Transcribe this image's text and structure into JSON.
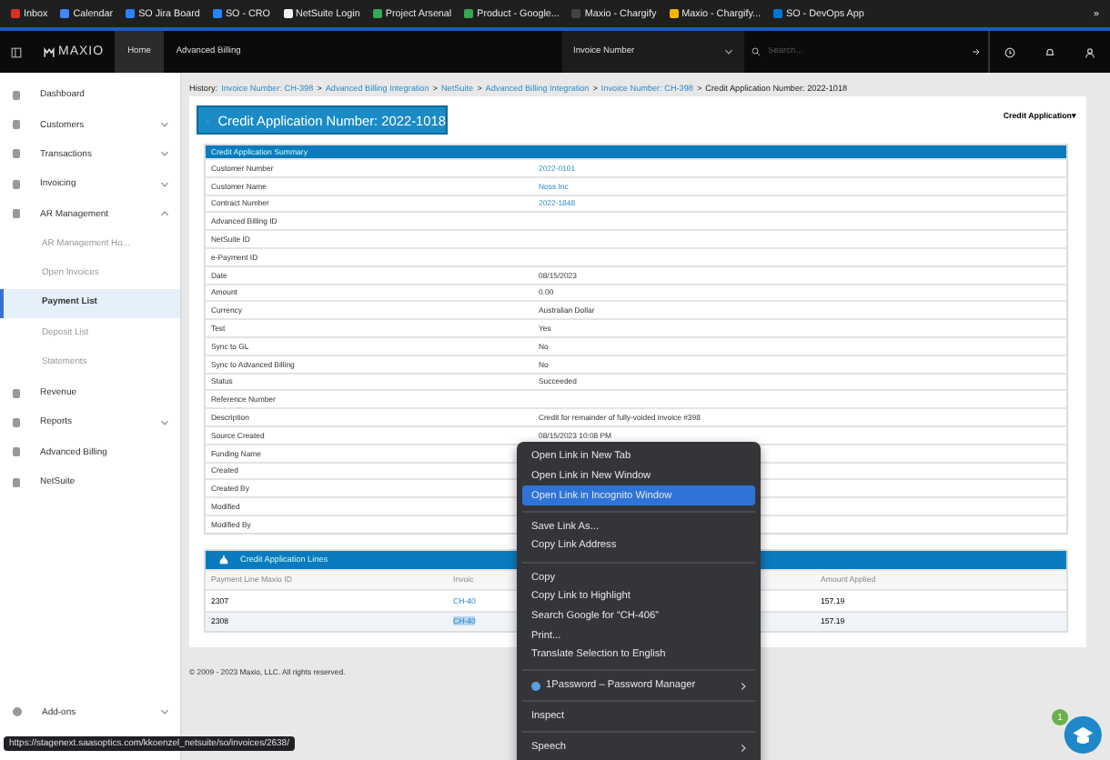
{
  "bookmarks": [
    {
      "label": "Inbox",
      "color": "#d93025"
    },
    {
      "label": "Calendar",
      "color": "#4285f4"
    },
    {
      "label": "SO Jira Board",
      "color": "#2684ff"
    },
    {
      "label": "SO - CRO",
      "color": "#2684ff"
    },
    {
      "label": "NetSuite Login",
      "color": "#f2f2f2"
    },
    {
      "label": "Project Arsenal",
      "color": "#34a853"
    },
    {
      "label": "Product - Google...",
      "color": "#34a853"
    },
    {
      "label": "Maxio - Chargify",
      "color": "#444444"
    },
    {
      "label": "Maxio - Chargify...",
      "color": "#f4b400"
    },
    {
      "label": "SO - DevOps App",
      "color": "#0078d4"
    }
  ],
  "bookmarks_more": "»",
  "nav": {
    "logo": "MAXIO",
    "tabs": [
      {
        "label": "Home",
        "selected": true
      },
      {
        "label": "Advanced Billing",
        "selected": false
      }
    ],
    "search_type": "Invoice Number",
    "search_placeholder": "Search..."
  },
  "sidebar": {
    "items": [
      {
        "label": "Dashboard",
        "selected": false
      },
      {
        "label": "Customers",
        "selected": false,
        "expanded": false
      },
      {
        "label": "Transactions",
        "selected": false,
        "expanded": false
      },
      {
        "label": "Invoicing",
        "selected": false,
        "expanded": false
      },
      {
        "label": "AR Management",
        "selected": false,
        "expanded": true,
        "children": [
          {
            "label": "AR Management Ho...",
            "selected": false
          },
          {
            "label": "Open Invoices",
            "selected": false
          },
          {
            "label": "Payment List",
            "selected": true
          },
          {
            "label": "Deposit List",
            "selected": false
          },
          {
            "label": "Statements",
            "selected": false
          }
        ]
      },
      {
        "label": "Revenue",
        "selected": false
      },
      {
        "label": "Reports",
        "selected": false,
        "expanded": false
      },
      {
        "label": "Advanced Billing",
        "selected": false
      },
      {
        "label": "NetSuite",
        "selected": false
      }
    ],
    "footer_item": {
      "label": "Add-ons",
      "expanded": false
    }
  },
  "breadcrumb": [
    {
      "kind": "label",
      "text": "History:"
    },
    {
      "kind": "link",
      "text": "Invoice Number: CH-398"
    },
    {
      "kind": "sep",
      "text": ">"
    },
    {
      "kind": "link",
      "text": "Advanced Billing Integration"
    },
    {
      "kind": "sep",
      "text": ">"
    },
    {
      "kind": "link",
      "text": "NetSuite"
    },
    {
      "kind": "sep",
      "text": ">"
    },
    {
      "kind": "link",
      "text": "Advanced Billing Integration"
    },
    {
      "kind": "sep",
      "text": ">"
    },
    {
      "kind": "link",
      "text": "Invoice Number: CH-398"
    },
    {
      "kind": "sep",
      "text": ">"
    },
    {
      "kind": "current",
      "text": "Credit Application Number: 2022-1018"
    }
  ],
  "title": "Credit Application Number: 2022-1018",
  "actions_menu": "Credit Application▾",
  "summary": {
    "heading": "Credit Application Summary",
    "rows": [
      {
        "label": "Customer Number",
        "value": "2022-0101",
        "link": true
      },
      {
        "label": "Customer Name",
        "value": "Noss Inc",
        "link": true
      },
      {
        "label": "Contract Number",
        "value": "2022-1848",
        "link": true
      },
      {
        "label": "Advanced Billing ID"
      },
      {
        "label": "NetSuite ID"
      },
      {
        "label": "e-Payment ID"
      },
      {
        "label": "Date",
        "value": "08/15/2023",
        "link": false
      },
      {
        "label": "Amount",
        "value": "0.00",
        "link": false
      },
      {
        "label": "Currency",
        "value": "Australian Dollar",
        "link": false
      },
      {
        "label": "Test",
        "value": "Yes",
        "link": false
      },
      {
        "label": "Sync to GL",
        "value": "No",
        "link": false
      },
      {
        "label": "Sync to Advanced Billing",
        "value": "No",
        "link": false
      },
      {
        "label": "Status",
        "value": "Succeeded",
        "link": false
      },
      {
        "label": "Reference Number"
      },
      {
        "label": "Description",
        "value": "Credit for remainder of fully-voided invoice #398",
        "link": false
      },
      {
        "label": "Source Created",
        "value": "08/15/2023 10:08 PM",
        "link": false
      },
      {
        "label": "Funding Name"
      },
      {
        "label": "Created"
      },
      {
        "label": "Created By"
      },
      {
        "label": "Modified"
      },
      {
        "label": "Modified By"
      }
    ]
  },
  "lines": {
    "heading": "Credit Application Lines",
    "columns": [
      "Payment Line Maxio ID",
      "Invoic",
      "Amount Applied"
    ],
    "rows": [
      {
        "id": "2307",
        "invoice": "CH-40",
        "amount": "157.19",
        "selected": false
      },
      {
        "id": "2308",
        "invoice": "CH-40",
        "amount": "157.19",
        "selected": true
      }
    ]
  },
  "footer": "© 2009 - 2023 Maxio, LLC. All rights reserved.",
  "context_menu": {
    "groups": [
      [
        {
          "label": "Open Link in New Tab",
          "selected": false,
          "submenu": false
        },
        {
          "label": "Open Link in New Window",
          "selected": false,
          "submenu": false
        },
        {
          "label": "Open Link in Incognito Window",
          "selected": true,
          "submenu": false
        }
      ],
      [
        {
          "label": "Save Link As...",
          "selected": false,
          "submenu": false
        },
        {
          "label": "Copy Link Address",
          "selected": false,
          "submenu": false
        }
      ],
      [
        {
          "label": "Copy",
          "selected": false,
          "submenu": false
        },
        {
          "label": "Copy Link to Highlight",
          "selected": false,
          "submenu": false
        },
        {
          "label": "Search Google for “CH-406”",
          "selected": false,
          "submenu": false
        },
        {
          "label": "Print...",
          "selected": false,
          "submenu": false
        },
        {
          "label": "Translate Selection to English",
          "selected": false,
          "submenu": false
        }
      ],
      [
        {
          "label": "1Password – Password Manager",
          "selected": false,
          "submenu": true,
          "icon": true
        }
      ],
      [
        {
          "label": "Inspect",
          "selected": false,
          "submenu": false
        }
      ],
      [
        {
          "label": "Speech",
          "selected": false,
          "submenu": true
        }
      ]
    ]
  },
  "status_url": "https://stagenext.saasoptics.com/kkoenzel_netsuite/so/invoices/2638/",
  "chat_badge": "1"
}
